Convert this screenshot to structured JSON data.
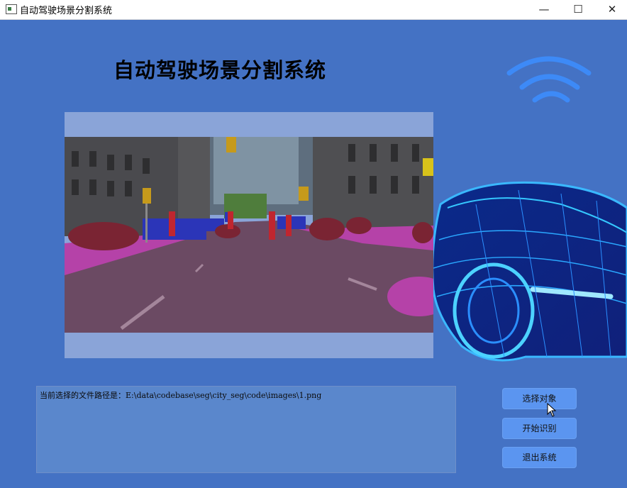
{
  "window": {
    "title": "自动驾驶场景分割系统",
    "controls": {
      "minimize": "—",
      "maximize": "☐",
      "close": "✕"
    }
  },
  "header": {
    "title": "自动驾驶场景分割系统"
  },
  "decor": {
    "wifi_icon": "wifi-signal-icon",
    "car_image": "wireframe-car-illustration"
  },
  "image_view": {
    "content": "segmented-street-scene"
  },
  "file_path": {
    "text": "当前选择的文件路径是：E:\\data\\codebase\\seg\\city_seg\\code\\images\\1.png"
  },
  "buttons": {
    "select": "选择对象",
    "start": "开始识别",
    "exit": "退出系统"
  },
  "colors": {
    "background": "#4472c4",
    "button": "#5b95f0",
    "path_box": "#5a87cc",
    "image_frame": "#8aa4d8"
  }
}
